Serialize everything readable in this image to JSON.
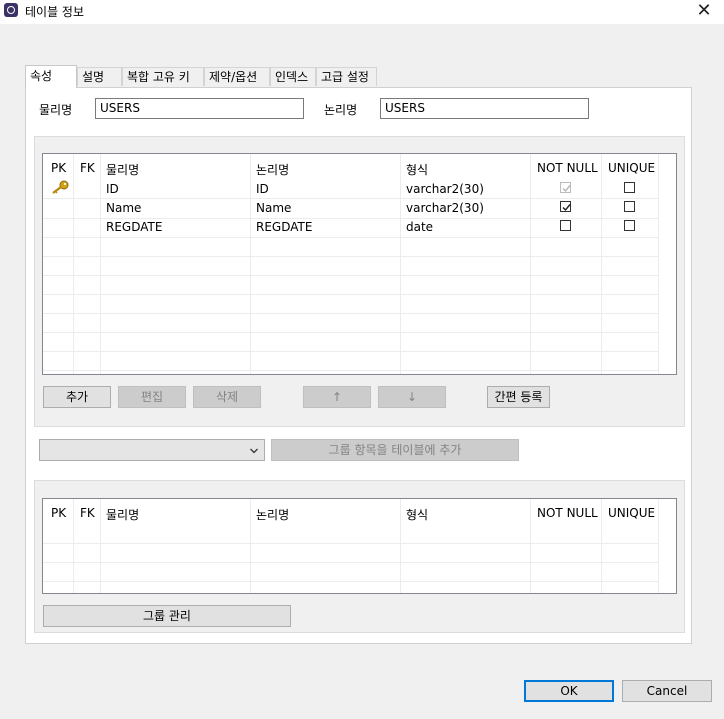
{
  "window": {
    "title": "테이블 정보",
    "close_glyph": "✕"
  },
  "tabs": [
    {
      "label": "속성"
    },
    {
      "label": "설명"
    },
    {
      "label": "복합 고유 키"
    },
    {
      "label": "제약/옵션"
    },
    {
      "label": "인덱스"
    },
    {
      "label": "고급 설정"
    }
  ],
  "names": {
    "physical_label": "물리명",
    "physical_value": "USERS",
    "logical_label": "논리명",
    "logical_value": "USERS"
  },
  "columns_grid": {
    "headers": [
      "PK",
      "FK",
      "물리명",
      "논리명",
      "형식",
      "NOT NULL",
      "UNIQUE"
    ],
    "rows": [
      {
        "pk": true,
        "fk": false,
        "physical": "ID",
        "logical": "ID",
        "type": "varchar2(30)",
        "not_null": true,
        "not_null_disabled": true,
        "unique": false
      },
      {
        "pk": false,
        "fk": false,
        "physical": "Name",
        "logical": "Name",
        "type": "varchar2(30)",
        "not_null": true,
        "not_null_disabled": false,
        "unique": false
      },
      {
        "pk": false,
        "fk": false,
        "physical": "REGDATE",
        "logical": "REGDATE",
        "type": "date",
        "not_null": false,
        "not_null_disabled": false,
        "unique": false
      }
    ]
  },
  "column_buttons": {
    "add": "추가",
    "edit": "편집",
    "delete": "삭제",
    "up": "↑",
    "down": "↓",
    "quick_register": "간편 등록"
  },
  "group": {
    "select_value": "",
    "add_to_table": "그룹 항목을 테이블에 추가",
    "manage": "그룹 관리"
  },
  "group_grid": {
    "headers": [
      "PK",
      "FK",
      "물리명",
      "논리명",
      "형식",
      "NOT NULL",
      "UNIQUE"
    ],
    "rows": []
  },
  "footer": {
    "ok": "OK",
    "cancel": "Cancel"
  },
  "colors": {
    "accent": "#0078d7",
    "window_bg": "#f0f0f0",
    "key_icon": "#d4a017"
  }
}
